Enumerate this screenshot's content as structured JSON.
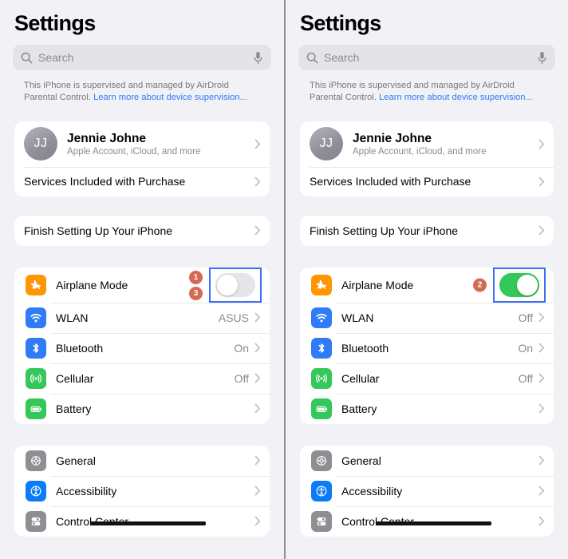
{
  "app": {
    "title": "Settings",
    "search": {
      "placeholder": "Search",
      "value": ""
    },
    "supervision": {
      "text": "This iPhone is supervised and managed by AirDroid Parental Control. ",
      "link": "Learn more about device supervision..."
    }
  },
  "account": {
    "initials": "JJ",
    "name": "Jennie Johne",
    "subtitle": "Apple Account, iCloud, and more",
    "services_label": "Services Included with Purchase"
  },
  "finish": {
    "label": "Finish Setting Up Your iPhone"
  },
  "connectivity": {
    "airplane_label": "Airplane Mode",
    "wlan_label": "WLAN",
    "bluetooth_label": "Bluetooth",
    "cellular_label": "Cellular",
    "battery_label": "Battery"
  },
  "system": {
    "general_label": "General",
    "accessibility_label": "Accessibility",
    "control_center_label": "Control Center"
  },
  "left_panel": {
    "airplane_state": "off",
    "wlan_value": "ASUS",
    "bluetooth_value": "On",
    "cellular_value": "Off",
    "battery_value": "",
    "badge_top": "1",
    "badge_bottom": "3"
  },
  "right_panel": {
    "airplane_state": "on",
    "wlan_value": "Off",
    "bluetooth_value": "On",
    "cellular_value": "Off",
    "battery_value": "",
    "badge_mid": "2"
  },
  "colors": {
    "background": "#f1f1f6",
    "card": "#ffffff",
    "accent_blue": "#2f7cf6",
    "highlight_blue": "#3b6ef5",
    "toggle_on_green": "#34c759",
    "toggle_off_gray": "#e6e6ea",
    "badge_red": "#cd482e",
    "secondary_text": "#8a8a8e",
    "icon_airplane": "#ff9500",
    "icon_wlan": "#2f7cf6",
    "icon_bluetooth": "#2f7cf6",
    "icon_cellular": "#34c759",
    "icon_battery": "#34c759",
    "icon_general": "#8e8e93",
    "icon_accessibility": "#0a7cf6",
    "icon_control_center": "#8e8e93"
  },
  "icons": {
    "search": "search-icon",
    "mic": "microphone-icon",
    "chevron": "chevron-right-icon",
    "airplane": "airplane-icon",
    "wlan": "wifi-icon",
    "bluetooth": "bluetooth-icon",
    "cellular": "cellular-antenna-icon",
    "battery": "battery-icon",
    "general": "gear-icon",
    "accessibility": "accessibility-icon",
    "control_center": "control-center-icon"
  }
}
